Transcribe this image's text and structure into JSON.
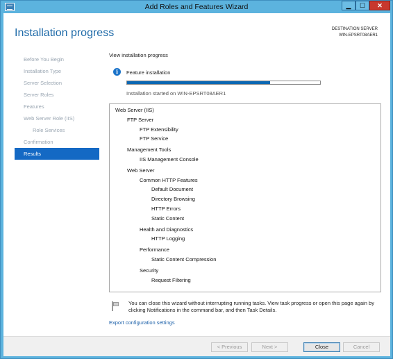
{
  "window": {
    "title": "Add Roles and Features Wizard",
    "controls": {
      "minimize": "▁",
      "maximize": "☐",
      "close": "✕"
    }
  },
  "header": {
    "title": "Installation progress",
    "destination_label": "DESTINATION SERVER",
    "destination_server": "WIN-EPSRT08AER1"
  },
  "nav": {
    "items": [
      {
        "label": "Before You Begin",
        "active": false,
        "indent": false
      },
      {
        "label": "Installation Type",
        "active": false,
        "indent": false
      },
      {
        "label": "Server Selection",
        "active": false,
        "indent": false
      },
      {
        "label": "Server Roles",
        "active": false,
        "indent": false
      },
      {
        "label": "Features",
        "active": false,
        "indent": false
      },
      {
        "label": "Web Server Role (IIS)",
        "active": false,
        "indent": false
      },
      {
        "label": "Role Services",
        "active": false,
        "indent": true
      },
      {
        "label": "Confirmation",
        "active": false,
        "indent": false
      },
      {
        "label": "Results",
        "active": true,
        "indent": false
      }
    ]
  },
  "main": {
    "view_label": "View installation progress",
    "feature_label": "Feature installation",
    "progress_fraction": 0.74,
    "started_text": "Installation started on WIN-EPSRT08AER1",
    "tree": [
      {
        "label": "Web Server (IIS)",
        "level": 0,
        "gap": false
      },
      {
        "label": "FTP Server",
        "level": 1,
        "gap": false
      },
      {
        "label": "FTP Extensibility",
        "level": 2,
        "gap": false
      },
      {
        "label": "FTP Service",
        "level": 2,
        "gap": false
      },
      {
        "label": "Management Tools",
        "level": 1,
        "gap": true
      },
      {
        "label": "IIS Management Console",
        "level": 2,
        "gap": false
      },
      {
        "label": "Web Server",
        "level": 1,
        "gap": true
      },
      {
        "label": "Common HTTP Features",
        "level": 2,
        "gap": false
      },
      {
        "label": "Default Document",
        "level": 3,
        "gap": false
      },
      {
        "label": "Directory Browsing",
        "level": 3,
        "gap": false
      },
      {
        "label": "HTTP Errors",
        "level": 3,
        "gap": false
      },
      {
        "label": "Static Content",
        "level": 3,
        "gap": false
      },
      {
        "label": "Health and Diagnostics",
        "level": 2,
        "gap": true
      },
      {
        "label": "HTTP Logging",
        "level": 3,
        "gap": false
      },
      {
        "label": "Performance",
        "level": 2,
        "gap": true
      },
      {
        "label": "Static Content Compression",
        "level": 3,
        "gap": false
      },
      {
        "label": "Security",
        "level": 2,
        "gap": true
      },
      {
        "label": "Request Filtering",
        "level": 3,
        "gap": false
      }
    ],
    "note": "You can close this wizard without interrupting running tasks. View task progress or open this page again by clicking Notifications in the command bar, and then Task Details.",
    "export_link": "Export configuration settings"
  },
  "footer": {
    "previous": "< Previous",
    "next": "Next >",
    "close": "Close",
    "cancel": "Cancel"
  },
  "colors": {
    "titlebar": "#5cb3de",
    "accent": "#1469c4",
    "title_text": "#1e6aa8",
    "progress": "#0b67b3"
  }
}
